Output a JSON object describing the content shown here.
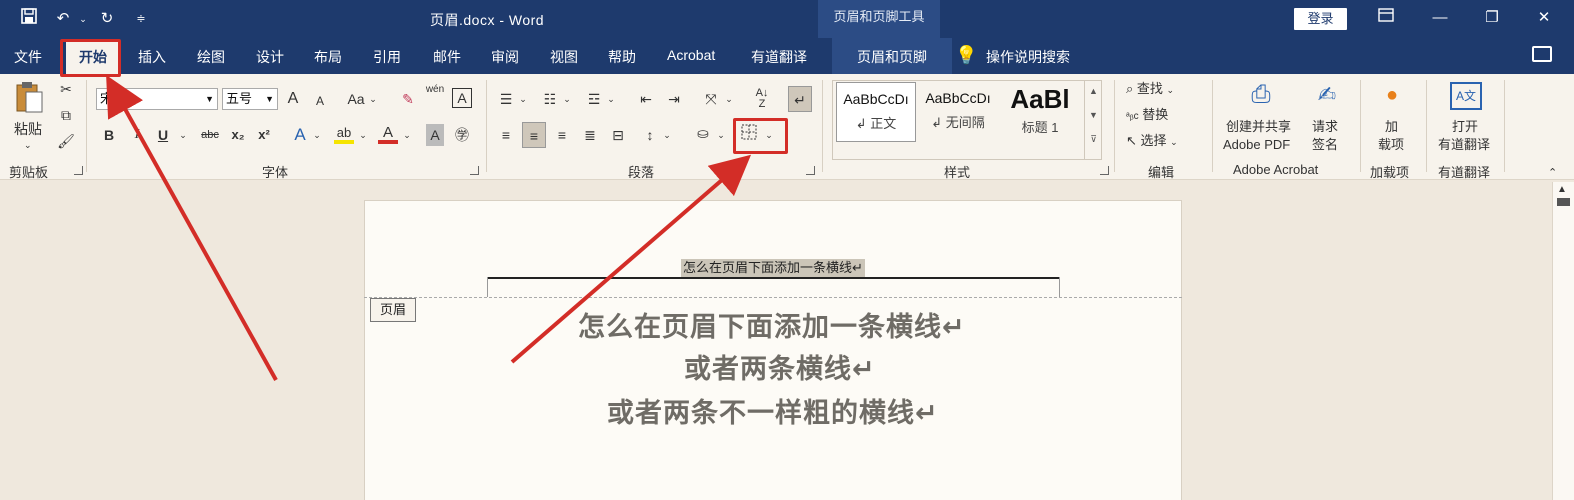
{
  "titlebar": {
    "doc_title": "页眉.docx  -  Word",
    "context_tools": "页眉和页脚工具",
    "login": "登录",
    "icons": {
      "save": "save-icon",
      "undo": "undo-icon",
      "redo": "redo-icon",
      "customize": "customize-qat-icon"
    }
  },
  "tabs": {
    "file": "文件",
    "home": "开始",
    "insert": "插入",
    "draw": "绘图",
    "design": "设计",
    "layout": "布局",
    "references": "引用",
    "mailings": "邮件",
    "review": "审阅",
    "view": "视图",
    "help": "帮助",
    "acrobat": "Acrobat",
    "youdao": "有道翻译",
    "header_footer": "页眉和页脚",
    "tell_me": "操作说明搜索"
  },
  "ribbon": {
    "clipboard": {
      "paste": "粘贴",
      "label": "剪贴板"
    },
    "font": {
      "name": "宋体",
      "size": "五号",
      "label": "字体",
      "bold": "B",
      "italic": "I",
      "underline": "U",
      "strike": "abc",
      "sub": "x₂",
      "sup": "x²",
      "grow": "A",
      "shrink": "A",
      "case": "Aa",
      "wen": "wén",
      "box_a": "A"
    },
    "paragraph": {
      "label": "段落"
    },
    "styles": {
      "label": "样式",
      "items": [
        {
          "preview": "AaBbCcDı",
          "name": "↲ 正文"
        },
        {
          "preview": "AaBbCcDı",
          "name": "↲ 无间隔"
        },
        {
          "preview": "AaBl",
          "name": "标题 1"
        }
      ]
    },
    "editing": {
      "find": "查找",
      "replace": "替换",
      "select": "选择",
      "label": "编辑"
    },
    "adobe": {
      "create_line1": "创建并共享",
      "create_line2": "Adobe PDF",
      "sign_line1": "请求",
      "sign_line2": "签名",
      "label": "Adobe Acrobat"
    },
    "addins": {
      "line1": "加",
      "line2": "载项",
      "label": "加载项"
    },
    "youdao": {
      "line1": "打开",
      "line2": "有道翻译",
      "label": "有道翻译"
    }
  },
  "document": {
    "header_text": "怎么在页眉下面添加一条横线↵",
    "header_tag": "页眉",
    "lines": [
      "怎么在页眉下面添加一条横线↵",
      "或者两条横线↵",
      "或者两条不一样粗的横线↵"
    ]
  },
  "colors": {
    "titlebar": "#1e3a6d",
    "ribbon": "#f7f3ec",
    "highlight": "#d32d27",
    "font_color_bar": "#d32d27",
    "highlighter_bar": "#f5e400"
  }
}
